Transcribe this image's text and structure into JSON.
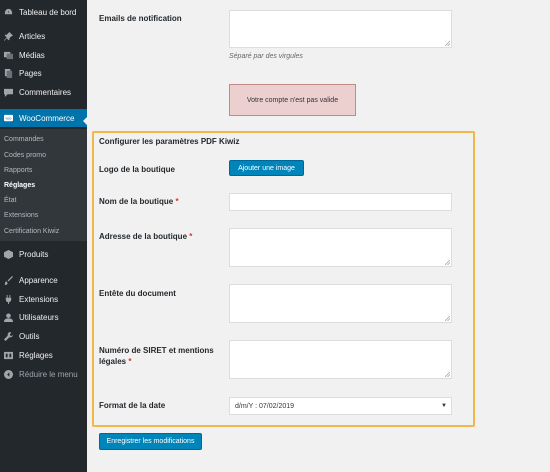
{
  "sidebar": {
    "items": [
      {
        "label": "Tableau de bord",
        "icon": "dashboard-icon"
      },
      {
        "label": "Articles",
        "icon": "pin-icon"
      },
      {
        "label": "Médias",
        "icon": "media-icon"
      },
      {
        "label": "Pages",
        "icon": "pages-icon"
      },
      {
        "label": "Commentaires",
        "icon": "comment-icon"
      },
      {
        "label": "WooCommerce",
        "icon": "woocommerce-icon"
      },
      {
        "label": "Produits",
        "icon": "products-icon"
      },
      {
        "label": "Apparence",
        "icon": "appearance-icon"
      },
      {
        "label": "Extensions",
        "icon": "plugins-icon"
      },
      {
        "label": "Utilisateurs",
        "icon": "users-icon"
      },
      {
        "label": "Outils",
        "icon": "tools-icon"
      },
      {
        "label": "Réglages",
        "icon": "settings-icon"
      },
      {
        "label": "Réduire le menu",
        "icon": "collapse-icon"
      }
    ],
    "submenu": [
      "Commandes",
      "Codes promo",
      "Rapports",
      "Réglages",
      "État",
      "Extensions",
      "Certification Kiwiz"
    ],
    "active_submenu": "Réglages",
    "accent_color": "#0073aa"
  },
  "main": {
    "notification": {
      "label": "Emails de notification",
      "hint": "Séparé par des virgules"
    },
    "error_message": "Votre compte n'est pas valide",
    "section_title": "Configurer les paramètres PDF Kiwiz",
    "fields": {
      "logo_label": "Logo de la boutique",
      "logo_button": "Ajouter une image",
      "shop_name_label": "Nom de la boutique",
      "address_label": "Adresse de la boutique",
      "header_label": "Entête du document",
      "siret_label_line1": "Numéro de SIRET et mentions",
      "siret_label_line2": "légales",
      "date_format_label": "Format de la date",
      "date_format_value": "d/m/Y : 07/02/2019",
      "required_mark": "*"
    },
    "save_button": "Enregistrer les modifications",
    "highlight_color": "#f0b849"
  }
}
